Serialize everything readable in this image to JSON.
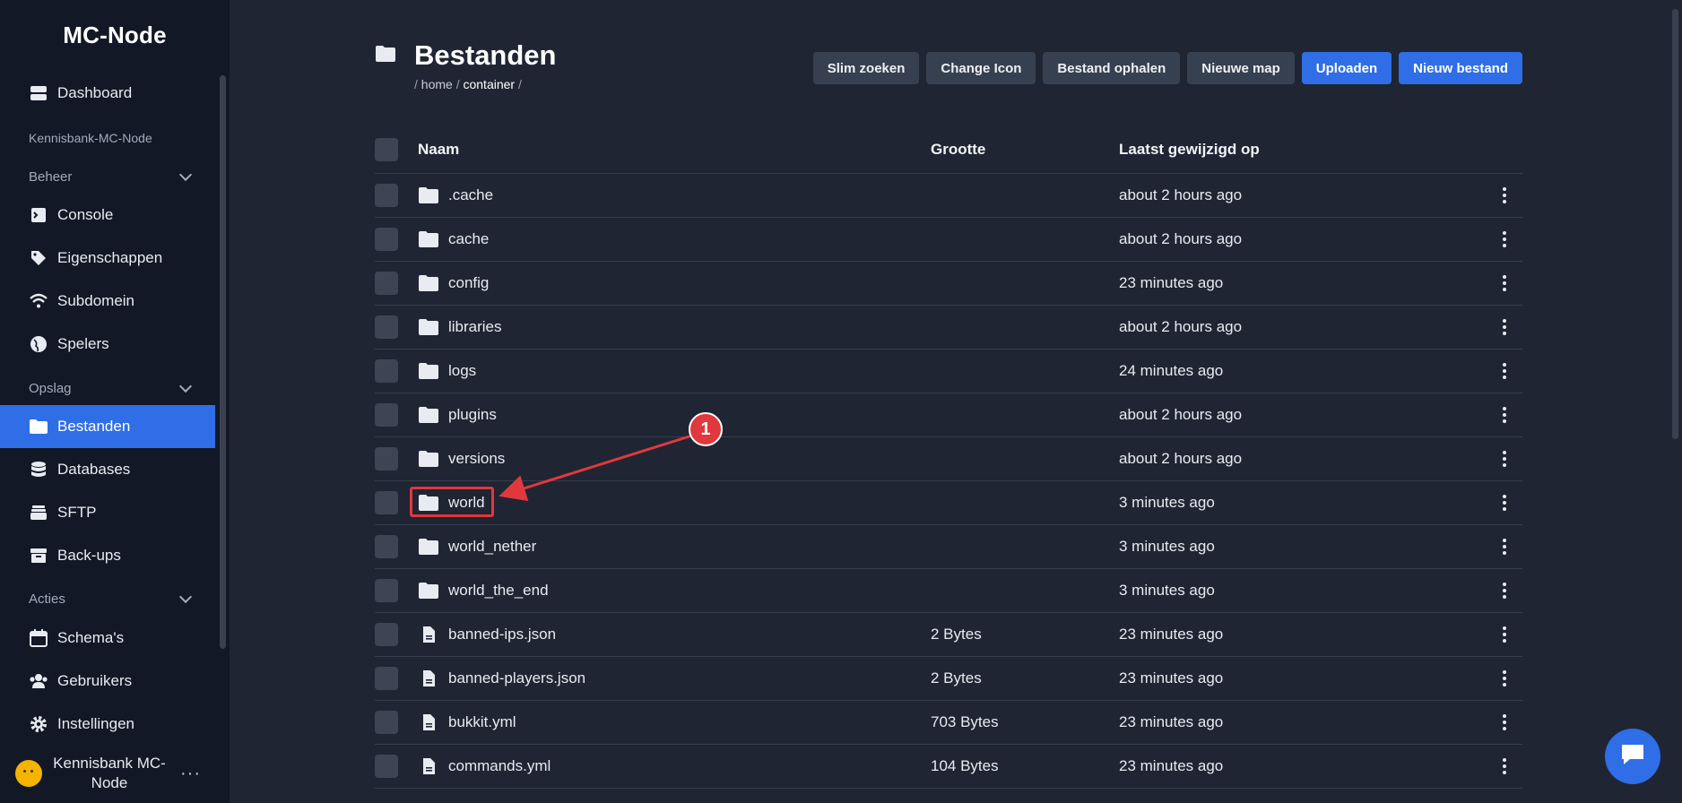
{
  "app": {
    "brand": "MC-Node"
  },
  "sidebar": {
    "dashboard": "Dashboard",
    "server_label": "Kennisbank-MC-Node",
    "section_beheer": "Beheer",
    "beheer_items": [
      "Console",
      "Eigenschappen",
      "Subdomein",
      "Spelers"
    ],
    "section_opslag": "Opslag",
    "opslag_items": [
      "Bestanden",
      "Databases",
      "SFTP",
      "Back-ups"
    ],
    "section_acties": "Acties",
    "acties_items": [
      "Schema's",
      "Gebruikers",
      "Instellingen"
    ],
    "active": "Bestanden",
    "user_name": "Kennisbank MC-Node",
    "user_menu": "···"
  },
  "header": {
    "title": "Bestanden",
    "breadcrumb": [
      "home",
      "container"
    ]
  },
  "toolbar": {
    "buttons": [
      "Slim zoeken",
      "Change Icon",
      "Bestand ophalen",
      "Nieuwe map",
      "Uploaden",
      "Nieuw bestand"
    ]
  },
  "table": {
    "columns": {
      "name": "Naam",
      "size": "Grootte",
      "modified": "Laatst gewijzigd op"
    },
    "rows": [
      {
        "name": ".cache",
        "type": "folder",
        "size": "",
        "modified": "about 2 hours ago"
      },
      {
        "name": "cache",
        "type": "folder",
        "size": "",
        "modified": "about 2 hours ago"
      },
      {
        "name": "config",
        "type": "folder",
        "size": "",
        "modified": "23 minutes ago"
      },
      {
        "name": "libraries",
        "type": "folder",
        "size": "",
        "modified": "about 2 hours ago"
      },
      {
        "name": "logs",
        "type": "folder",
        "size": "",
        "modified": "24 minutes ago"
      },
      {
        "name": "plugins",
        "type": "folder",
        "size": "",
        "modified": "about 2 hours ago"
      },
      {
        "name": "versions",
        "type": "folder",
        "size": "",
        "modified": "about 2 hours ago"
      },
      {
        "name": "world",
        "type": "folder",
        "size": "",
        "modified": "3 minutes ago"
      },
      {
        "name": "world_nether",
        "type": "folder",
        "size": "",
        "modified": "3 minutes ago"
      },
      {
        "name": "world_the_end",
        "type": "folder",
        "size": "",
        "modified": "3 minutes ago"
      },
      {
        "name": "banned-ips.json",
        "type": "file",
        "size": "2 Bytes",
        "modified": "23 minutes ago"
      },
      {
        "name": "banned-players.json",
        "type": "file",
        "size": "2 Bytes",
        "modified": "23 minutes ago"
      },
      {
        "name": "bukkit.yml",
        "type": "file",
        "size": "703 Bytes",
        "modified": "23 minutes ago"
      },
      {
        "name": "commands.yml",
        "type": "file",
        "size": "104 Bytes",
        "modified": "23 minutes ago"
      }
    ]
  },
  "annotation": {
    "marker": "1",
    "target_row": "world"
  },
  "colors": {
    "accent": "#2f6ee6",
    "sidebar_bg": "#121826",
    "main_bg": "#1f2533",
    "annotation": "#e0383d"
  },
  "icons": {
    "folder": "folder-icon",
    "file": "file-icon",
    "chat": "chat-icon"
  }
}
